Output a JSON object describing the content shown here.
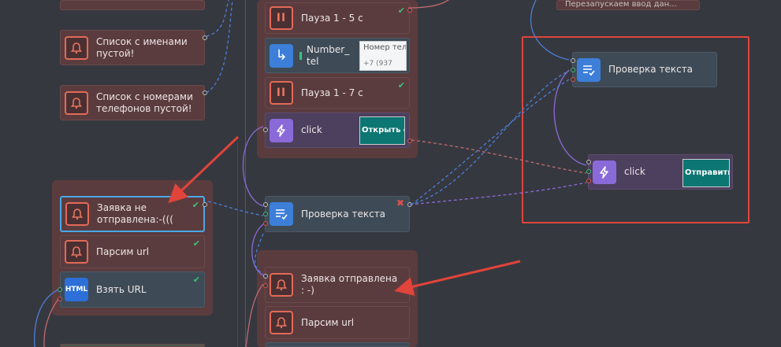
{
  "nodes": {
    "top_left_partial": "",
    "names_empty": "Список с именами пустой!",
    "phones_empty": "Список с номерами телефонов пустой!",
    "pause_5": "Пауза 1 - 5 с",
    "number_tel": "Number_tel",
    "number_tel_thumb_line1": "Номер тел",
    "number_tel_thumb_line2": "+7 (937",
    "pause_7": "Пауза 1 - 7 с",
    "click_1": "click",
    "click_1_thumb": "Открыть счё",
    "top_right_partial": "Перезапускаем ввод дан...",
    "text_check_right": "Проверка текста",
    "click_2": "click",
    "click_2_thumb": "Отправить заяв",
    "text_check_mid": "Проверка текста",
    "request_not_sent": "Заявка не отправлена:-(((",
    "parse_url_1": "Парсим url",
    "take_url": "Взять URL",
    "request_sent": "Заявка отправлена : -)",
    "parse_url_2": "Парсим url"
  },
  "icons": {
    "bell": "bell-icon",
    "pause": "pause-icon",
    "arrow": "redirect-arrow-icon",
    "check": "text-check-icon",
    "bolt": "lightning-icon",
    "html": "html-icon"
  },
  "icon_glyphs": {
    "pause": "II",
    "html": "HTML",
    "check_mark": "✔",
    "x_mark": "✖",
    "arrow": "↳"
  },
  "colors": {
    "background": "#36383f",
    "node_red": "#5b3c3e",
    "node_blue": "#3e4b57",
    "node_purple": "#4d3f5e",
    "highlight_frame": "#e0443a",
    "annotation_arrow": "#e0443a",
    "wire_blue": "#4a7fd8",
    "wire_purple": "#8a6ad8",
    "wire_red": "#c06a70"
  }
}
